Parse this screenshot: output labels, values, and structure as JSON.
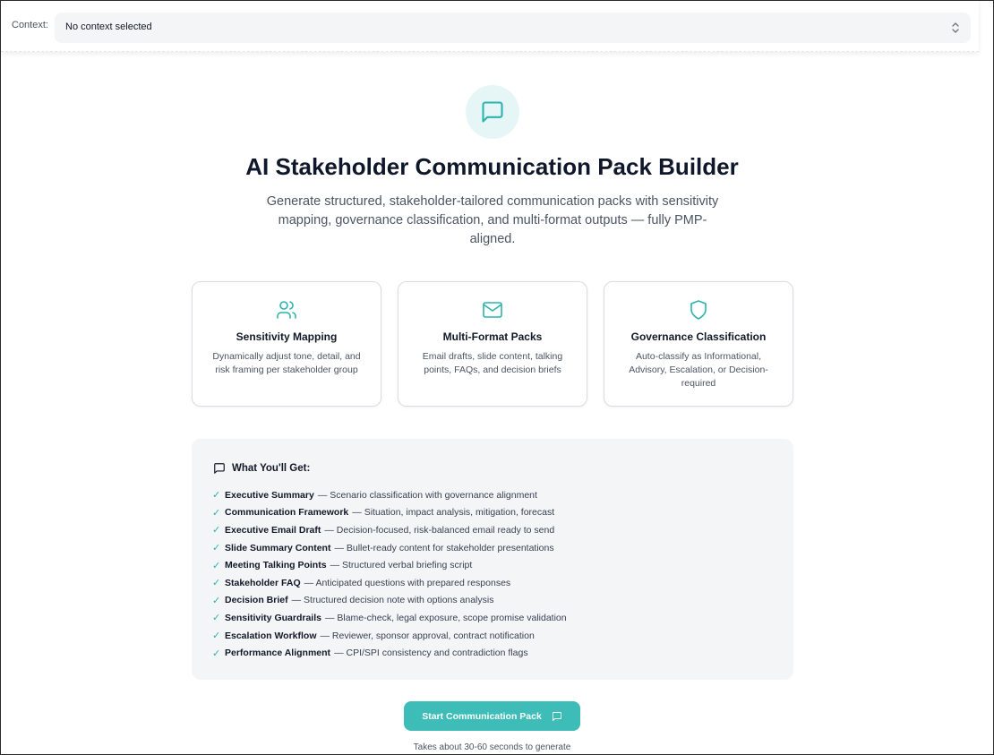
{
  "context": {
    "label": "Context:",
    "selected_value": "No context selected",
    "chevron_icon": "chevron-up-down-icon"
  },
  "hero": {
    "icon": "message-square-icon",
    "title": "AI Stakeholder Communication Pack Builder",
    "subtitle": "Generate structured, stakeholder-tailored communication packs with sensitivity mapping, governance classification, and multi-format outputs — fully PMP-aligned."
  },
  "features": [
    {
      "icon": "users-icon",
      "title": "Sensitivity Mapping",
      "description": "Dynamically adjust tone, detail, and risk framing per stakeholder group"
    },
    {
      "icon": "mail-icon",
      "title": "Multi-Format Packs",
      "description": "Email drafts, slide content, talking points, FAQs, and decision briefs"
    },
    {
      "icon": "shield-icon",
      "title": "Governance Classification",
      "description": "Auto-classify as Informational, Advisory, Escalation, or Decision-required"
    }
  ],
  "deliverables": {
    "title": "What You'll Get:",
    "icon": "message-square-icon",
    "check_symbol": "✓",
    "items": [
      {
        "name": "Executive Summary",
        "detail": "— Scenario classification with governance alignment"
      },
      {
        "name": "Communication Framework",
        "detail": "— Situation, impact analysis, mitigation, forecast"
      },
      {
        "name": "Executive Email Draft",
        "detail": "— Decision-focused, risk-balanced email ready to send"
      },
      {
        "name": "Slide Summary Content",
        "detail": "— Bullet-ready content for stakeholder presentations"
      },
      {
        "name": "Meeting Talking Points",
        "detail": "— Structured verbal briefing script"
      },
      {
        "name": "Stakeholder FAQ",
        "detail": "— Anticipated questions with prepared responses"
      },
      {
        "name": "Decision Brief",
        "detail": "— Structured decision note with options analysis"
      },
      {
        "name": "Sensitivity Guardrails",
        "detail": "— Blame-check, legal exposure, scope promise validation"
      },
      {
        "name": "Escalation Workflow",
        "detail": "— Reviewer, sponsor approval, contract notification"
      },
      {
        "name": "Performance Alignment",
        "detail": "— CPI/SPI consistency and contradiction flags"
      }
    ]
  },
  "cta": {
    "label": "Start Communication Pack",
    "icon": "message-square-icon",
    "note": "Takes about 30-60 seconds to generate"
  },
  "colors": {
    "accent": "#3ebcb8",
    "accent_light": "#e6f6f6",
    "check": "#2bb3ad",
    "panel_bg": "#f4f5f7"
  }
}
